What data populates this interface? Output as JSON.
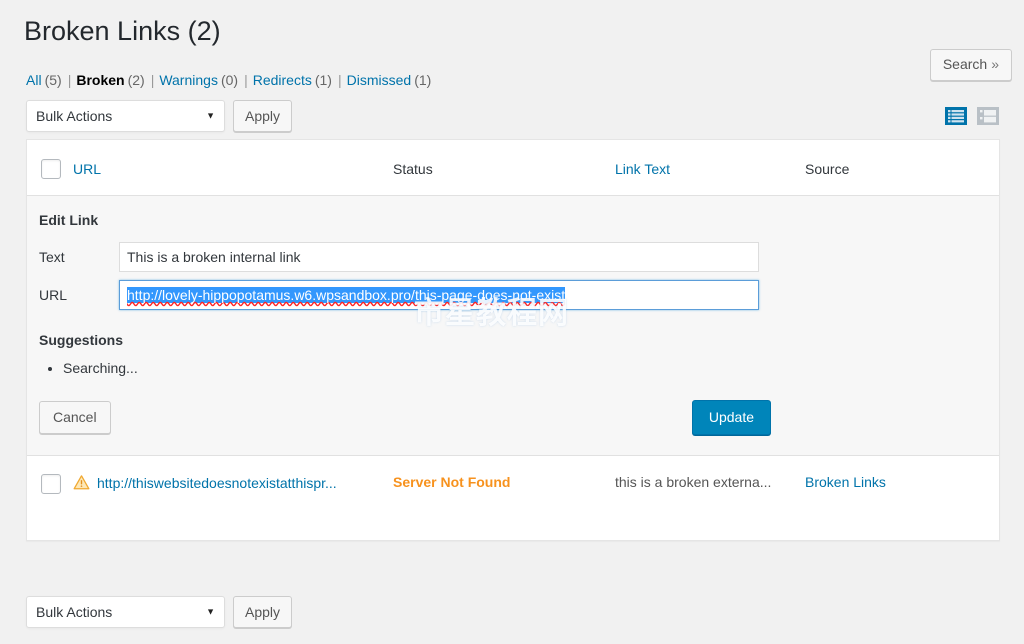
{
  "header": {
    "title": "Broken Links (2)",
    "search_label": "Search",
    "search_chevron": "»"
  },
  "filters": [
    {
      "label": "All",
      "count": "(5)",
      "current": false
    },
    {
      "label": "Broken",
      "count": "(2)",
      "current": true
    },
    {
      "label": "Warnings",
      "count": "(0)",
      "current": false
    },
    {
      "label": "Redirects",
      "count": "(1)",
      "current": false
    },
    {
      "label": "Dismissed",
      "count": "(1)",
      "current": false
    }
  ],
  "separator": "|",
  "tablenav_top": {
    "bulk_value": "Bulk Actions",
    "bulk_arrow": "▼",
    "apply_label": "Apply"
  },
  "tablenav_bottom": {
    "bulk_value": "Bulk Actions",
    "bulk_arrow": "▼",
    "apply_label": "Apply"
  },
  "view_switch": {
    "list_icon": "list-view-icon",
    "detail_icon": "detail-view-icon",
    "active": "list-view-icon",
    "active_color": "#0073aa",
    "inactive_color": "#b9c0c6"
  },
  "table": {
    "columns": [
      {
        "label": "URL",
        "sortable": true
      },
      {
        "label": "Status",
        "sortable": false
      },
      {
        "label": "Link Text",
        "sortable": true
      },
      {
        "label": "Source",
        "sortable": false
      }
    ]
  },
  "edit_link": {
    "heading": "Edit Link",
    "text_label": "Text",
    "text_value": "This is a broken internal link",
    "text_placeholder": "",
    "url_label": "URL",
    "url_value": "http://lovely-hippopotamus.w6.wpsandbox.pro/this-page-does-not-exist",
    "url_placeholder": "",
    "url_selected": true,
    "url_focus_color": "#3ea0dd",
    "selection_color": "#3297fd",
    "spellcheck_underline_color": "#ff2222",
    "suggestions_heading": "Suggestions",
    "suggestions": [
      "Searching..."
    ],
    "cancel_label": "Cancel",
    "update_label": "Update",
    "update_color": "#0085ba"
  },
  "rows": [
    {
      "checkbox": false,
      "warning_icon": "warning-triangle-icon",
      "url": "http://thiswebsitedoesnotexistatthispr...",
      "status": "Server Not Found",
      "status_color": "#f7921e",
      "link_text": "this is a broken externa...",
      "source": "Broken Links"
    }
  ],
  "watermark": "市星教程网"
}
